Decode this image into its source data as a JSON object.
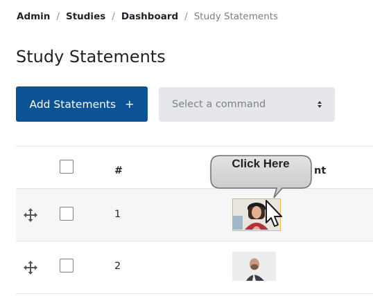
{
  "breadcrumb": {
    "items": [
      "Admin",
      "Studies",
      "Dashboard"
    ],
    "current": "Study Statements",
    "separator": "/"
  },
  "page": {
    "title": "Study Statements"
  },
  "toolbar": {
    "add_label": "Add Statements",
    "add_icon": "+",
    "command_placeholder": "Select a command"
  },
  "table": {
    "columns": {
      "number": "#",
      "statement_partial": "nt"
    },
    "rows": [
      {
        "number": "1",
        "thumbnail": "woman-portrait-photo"
      },
      {
        "number": "2",
        "thumbnail": "man-portrait-photo"
      }
    ]
  },
  "callout": {
    "label": "Click Here"
  },
  "colors": {
    "primary_button": "#0b5394",
    "select_bg": "#e5e7ea",
    "highlight_border": "#e8b54b",
    "row_alt": "#f5f6f7"
  }
}
